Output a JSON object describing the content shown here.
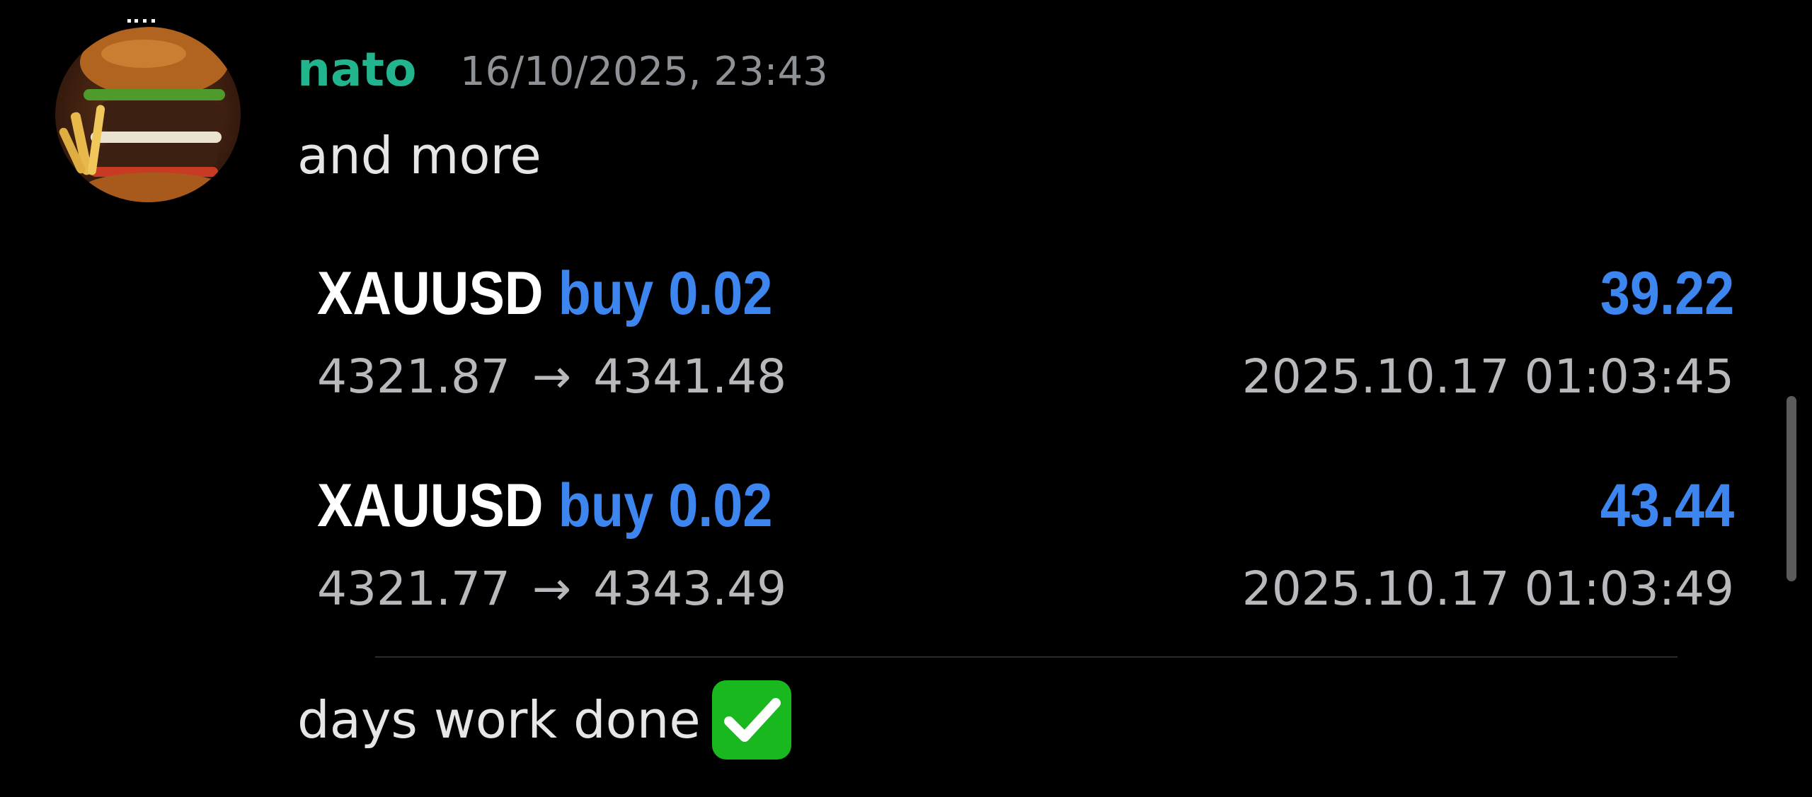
{
  "message": {
    "author": "nato",
    "timestamp": "16/10/2025, 23:43",
    "lines": [
      "and more",
      "days work done"
    ],
    "emoji": "white-check-mark"
  },
  "trades": [
    {
      "symbol": "XAUUSD",
      "side_volume": "buy 0.02",
      "profit": "39.22",
      "open_price": "4321.87",
      "arrow": "→",
      "close_price": "4341.48",
      "close_time": "2025.10.17 01:03:45"
    },
    {
      "symbol": "XAUUSD",
      "side_volume": "buy 0.02",
      "profit": "43.44",
      "open_price": "4321.77",
      "arrow": "→",
      "close_price": "4343.49",
      "close_time": "2025.10.17 01:03:49"
    }
  ],
  "colors": {
    "background": "#000000",
    "username": "#22b48c",
    "accent_blue": "#3d86f0",
    "muted_text": "#b9b9bd",
    "timestamp_text": "#8e9297",
    "check_green": "#18b81e"
  },
  "icons": {
    "avatar": "burger-avatar-image",
    "emoji": "white-check-mark-icon"
  }
}
